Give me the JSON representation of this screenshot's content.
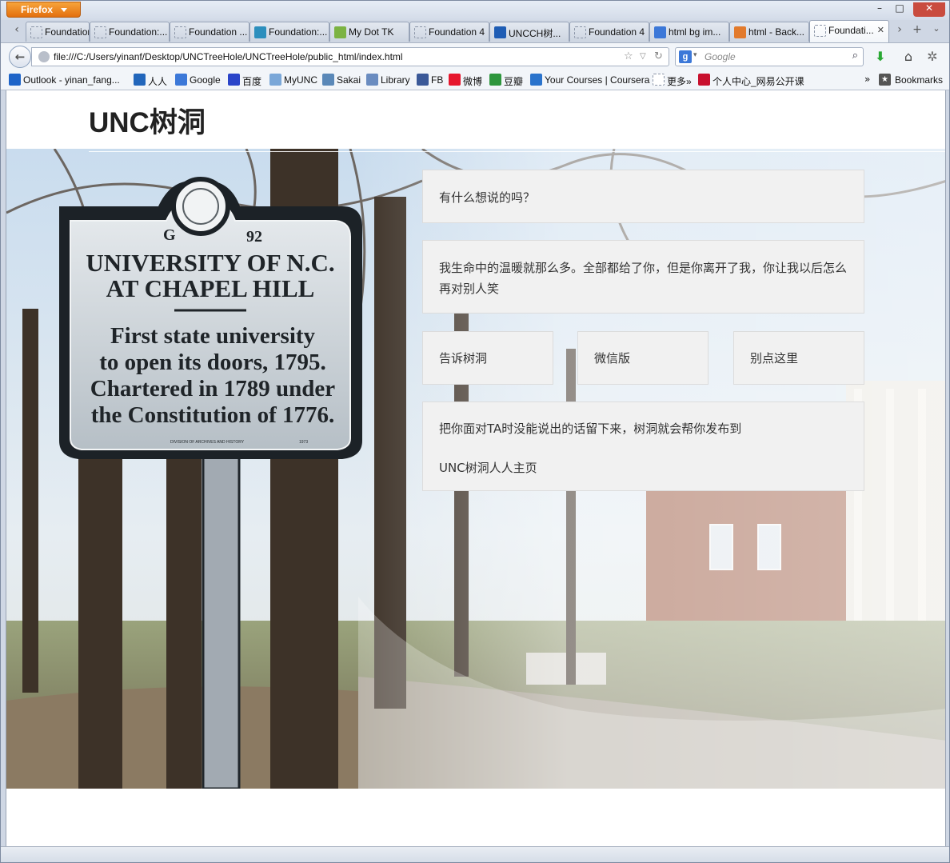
{
  "browser": {
    "menu_button": "Firefox",
    "window_controls": {
      "minimize": "–",
      "maximize": "□",
      "close": "✕"
    },
    "tabs": [
      {
        "label": "Foundation ...",
        "icon": "page-icon"
      },
      {
        "label": "Foundation:...",
        "icon": "page-icon"
      },
      {
        "label": "Foundation ...",
        "icon": "page-icon"
      },
      {
        "label": "Foundation:...",
        "icon": "foundation-icon"
      },
      {
        "label": "My Dot TK",
        "icon": "dottk-icon"
      },
      {
        "label": "Foundation 4",
        "icon": "page-icon"
      },
      {
        "label": "UNCCH树...",
        "icon": "renren-icon"
      },
      {
        "label": "Foundation 4",
        "icon": "page-icon"
      },
      {
        "label": "html bg im...",
        "icon": "google-icon"
      },
      {
        "label": "html - Back...",
        "icon": "stackoverflow-icon"
      },
      {
        "label": "Foundati...",
        "icon": "page-icon",
        "active": true
      }
    ],
    "url": "file:///C:/Users/yinanf/Desktop/UNCTreeHole/UNCTreeHole/public_html/index.html",
    "search_placeholder": "Google",
    "bookmarks": [
      {
        "label": "Outlook - yinan_fang...",
        "icon": "outlook-icon",
        "color": "#1e64c8"
      },
      {
        "label": "人人",
        "icon": "renren-icon",
        "color": "#2266bb"
      },
      {
        "label": "Google",
        "icon": "google-icon",
        "color": "#3c78d8"
      },
      {
        "label": "百度",
        "icon": "baidu-icon",
        "color": "#2a44c9"
      },
      {
        "label": "MyUNC",
        "icon": "myunc-icon",
        "color": "#7aa7d8"
      },
      {
        "label": "Sakai",
        "icon": "sakai-icon",
        "color": "#5a88b8"
      },
      {
        "label": "Library",
        "icon": "library-icon",
        "color": "#6a8cc0"
      },
      {
        "label": "FB",
        "icon": "facebook-icon",
        "color": "#3b5998"
      },
      {
        "label": "微博",
        "icon": "weibo-icon",
        "color": "#e6162d"
      },
      {
        "label": "豆瓣",
        "icon": "douban-icon",
        "color": "#2e963d"
      },
      {
        "label": "Your Courses | Coursera",
        "icon": "coursera-icon",
        "color": "#2a73cc"
      },
      {
        "label": "更多»",
        "icon": "page-icon",
        "color": "#ffffff"
      },
      {
        "label": "个人中心_网易公开课",
        "icon": "netease-icon",
        "color": "#c8102e"
      }
    ],
    "bookmarks_overflow": "»",
    "bookmarks_menu": "Bookmarks"
  },
  "site": {
    "title": "UNC树洞",
    "prompt": "有什么想说的吗？",
    "message": "我生命中的温暖就那么多。全部都给了你，但是你离开了我，你让我以后怎么再对别人笑",
    "buttons": {
      "tell": "告诉树洞",
      "wechat": "微信版",
      "nope": "别点这里"
    },
    "info_line1": "把你面对TA时没能说出的话留下来，树洞就会帮你发布到",
    "info_line2": "UNC树洞人人主页",
    "sign": {
      "marker": "G",
      "number": "92",
      "line1": "UNIVERSITY OF N.C.",
      "line2": "AT CHAPEL HILL",
      "body1": "First state university",
      "body2": "to open its doors, 1795.",
      "body3": "Chartered in 1789 under",
      "body4": "the Constitution of 1776.",
      "footer": "DIVISION OF ARCHIVES AND HISTORY",
      "year": "1973"
    }
  }
}
